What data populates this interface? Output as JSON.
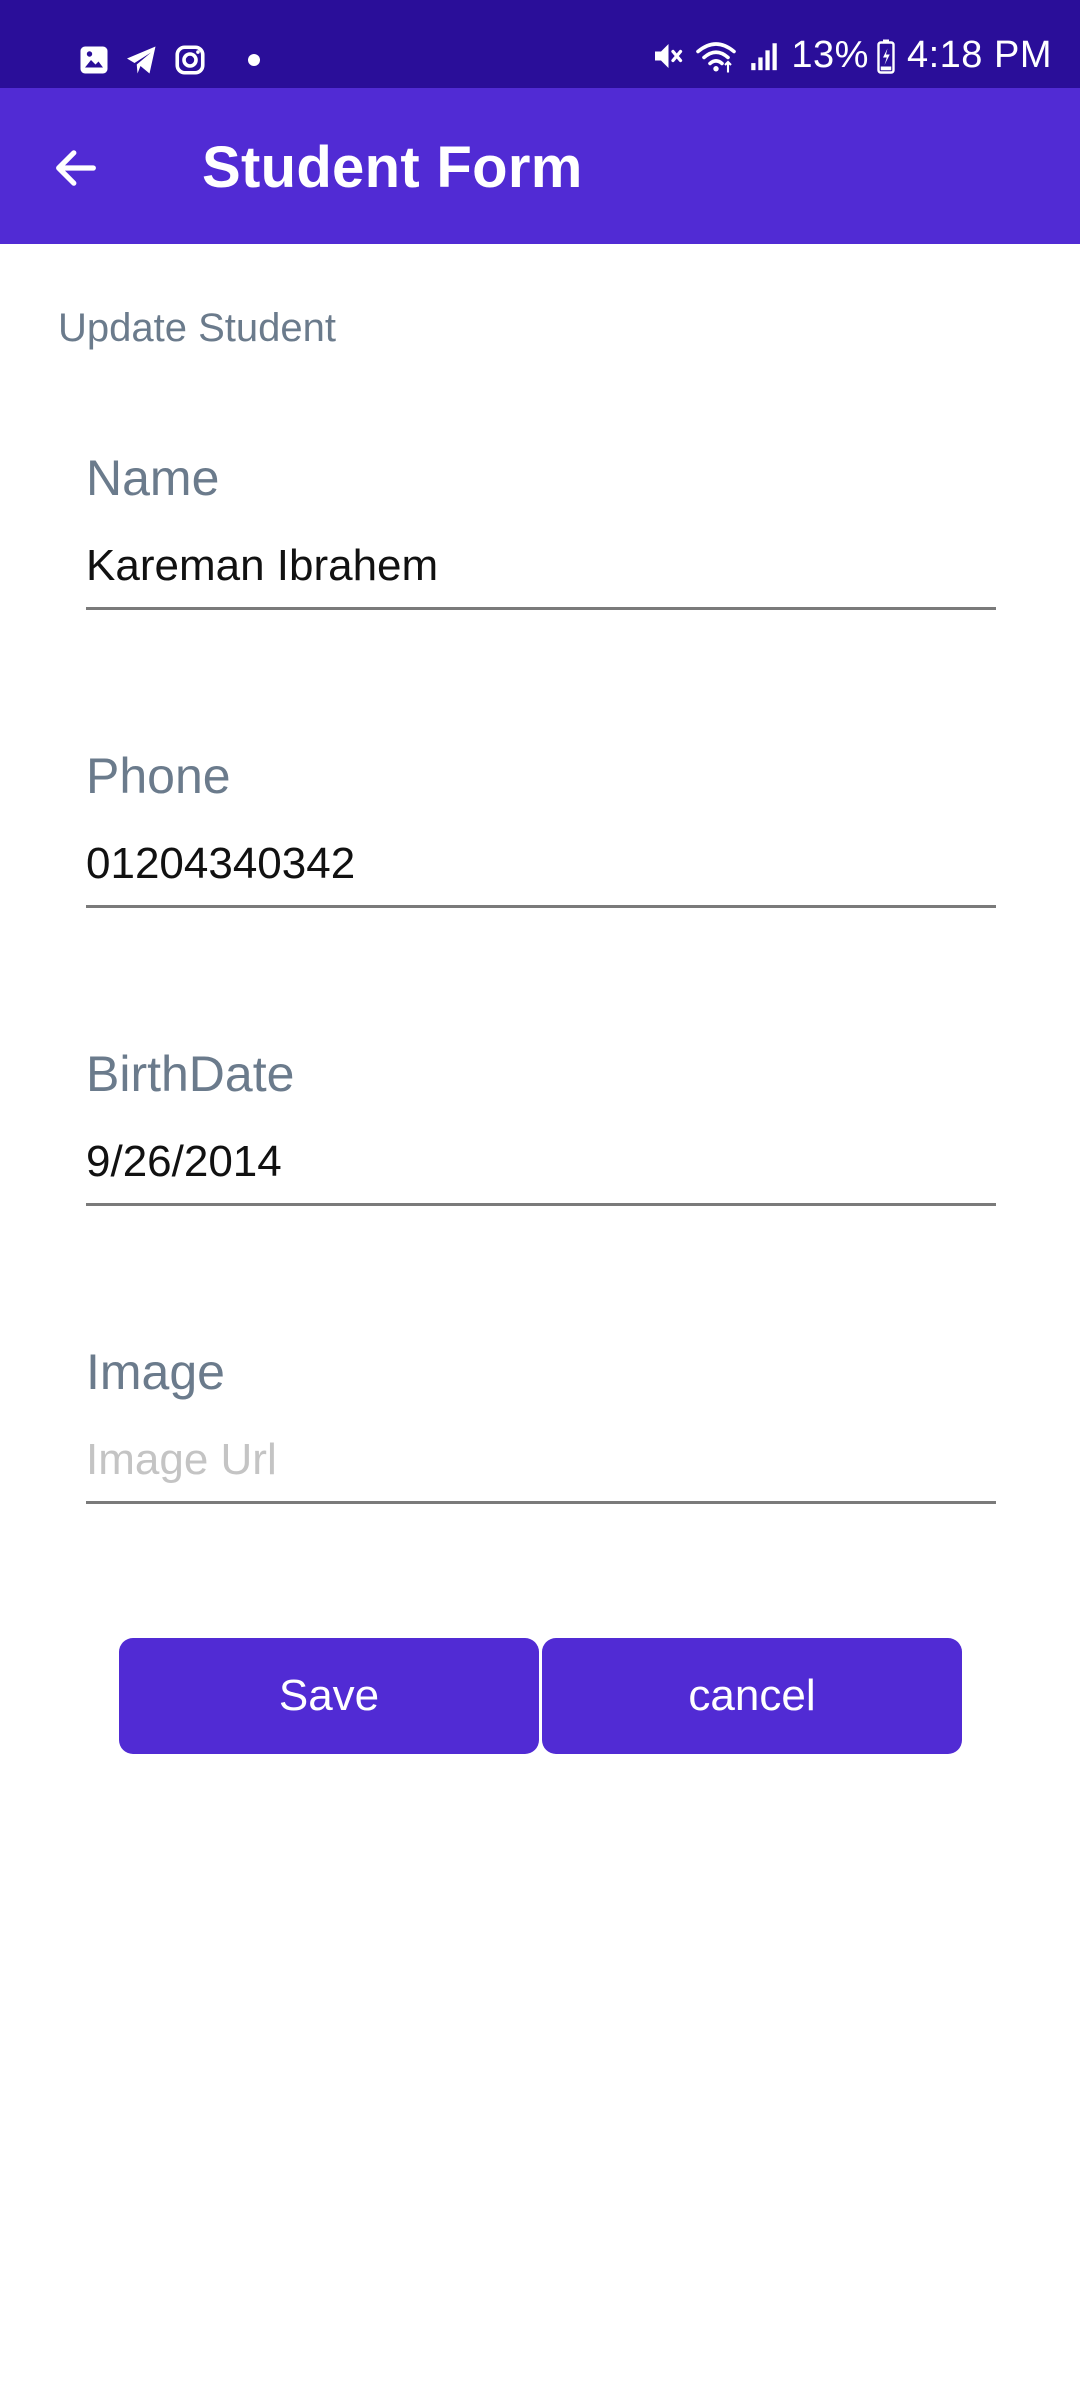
{
  "status_bar": {
    "battery": "13%",
    "time": "4:18 PM",
    "icons_left": [
      "gallery-icon",
      "telegram-icon",
      "instagram-icon",
      "notification-dot"
    ],
    "icons_right": [
      "mute-icon",
      "wifi-icon",
      "signal-icon",
      "battery-icon"
    ]
  },
  "app_bar": {
    "title": "Student Form",
    "back_icon": "arrow-back-icon"
  },
  "form": {
    "heading": "Update Student",
    "fields": {
      "name": {
        "label": "Name",
        "value": "Kareman Ibrahem",
        "placeholder": ""
      },
      "phone": {
        "label": "Phone",
        "value": "01204340342",
        "placeholder": ""
      },
      "birthdate": {
        "label": "BirthDate",
        "value": "9/26/2014",
        "placeholder": ""
      },
      "image": {
        "label": "Image",
        "value": "",
        "placeholder": "Image Url"
      }
    },
    "buttons": {
      "save": "Save",
      "cancel": "cancel"
    }
  },
  "colors": {
    "status_bar": "#2a0e99",
    "primary": "#512bd4",
    "label": "#6b7b8c",
    "placeholder": "#c4c4c4"
  }
}
